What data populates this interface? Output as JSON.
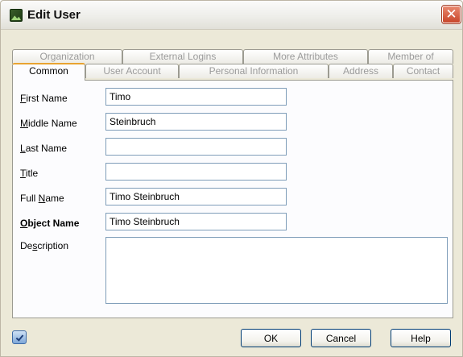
{
  "window": {
    "title": "Edit User",
    "close_glyph": "✕"
  },
  "tabs": {
    "row1": [
      "Organization",
      "External Logins",
      "More Attributes",
      "Member of"
    ],
    "row2": [
      "Common",
      "User Account",
      "Personal Information",
      "Address",
      "Contact"
    ],
    "active": "Common"
  },
  "form": {
    "first_name": {
      "label_prefix": "",
      "label_accel": "F",
      "label_rest": "irst Name",
      "value": "Timo"
    },
    "middle_name": {
      "label_prefix": "",
      "label_accel": "M",
      "label_rest": "iddle Name",
      "value": "Steinbruch"
    },
    "last_name": {
      "label_prefix": "",
      "label_accel": "L",
      "label_rest": "ast Name",
      "value": ""
    },
    "title": {
      "label_prefix": "",
      "label_accel": "T",
      "label_rest": "itle",
      "value": ""
    },
    "full_name": {
      "label_prefix": "Full ",
      "label_accel": "N",
      "label_rest": "ame",
      "value": "Timo Steinbruch"
    },
    "object_name": {
      "label_prefix": "",
      "label_accel": "O",
      "label_rest": "bject Name",
      "value": "Timo Steinbruch"
    },
    "description": {
      "label_prefix": "De",
      "label_accel": "s",
      "label_rest": "cription",
      "value": ""
    }
  },
  "buttons": {
    "ok": "OK",
    "cancel": "Cancel",
    "help": "Help"
  },
  "icons": {
    "app": "user-edit-app-icon",
    "help_context": "help-check-icon"
  }
}
